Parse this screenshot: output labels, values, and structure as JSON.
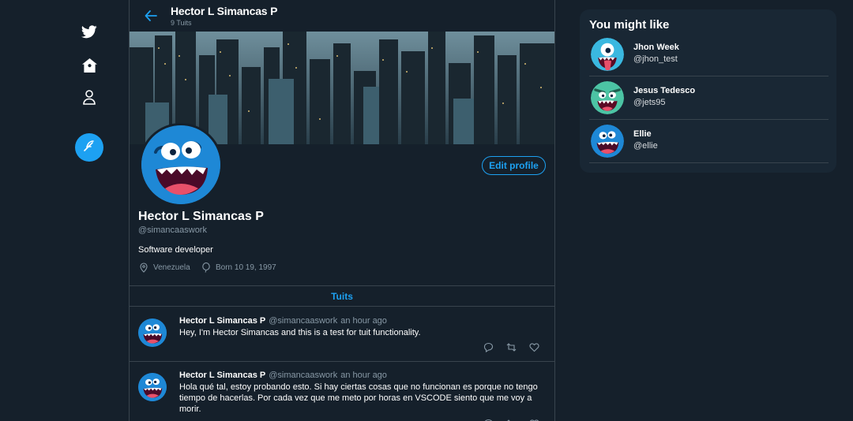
{
  "nav": {
    "items": [
      {
        "icon": "twitter-bird-icon"
      },
      {
        "icon": "home-icon"
      },
      {
        "icon": "profile-icon"
      }
    ],
    "compose_icon": "compose-feather-icon"
  },
  "header": {
    "name": "Hector L Simancas P",
    "tweet_count": "9 Tuits"
  },
  "profile": {
    "name": "Hector L Simancas P",
    "handle": "@simancaaswork",
    "bio": "Software developer",
    "location": "Venezuela",
    "birthday": "Born 10 19, 1997",
    "edit_label": "Edit profile"
  },
  "tabs": [
    {
      "label": "Tuits"
    }
  ],
  "tweets": [
    {
      "author": "Hector L Simancas P",
      "handle": "@simancaaswork",
      "time": "an hour ago",
      "text": "Hey, I'm Hector Simancas and this is a test for tuit functionality."
    },
    {
      "author": "Hector L Simancas P",
      "handle": "@simancaaswork",
      "time": "an hour ago",
      "text": "Hola qué tal, estoy probando esto. Si hay ciertas cosas que no funcionan es porque no tengo tiempo de hacerlas. Por cada vez que me meto por horas en VSCODE siento que me voy a morir."
    }
  ],
  "suggestions": {
    "title": "You might like",
    "users": [
      {
        "name": "Jhon Week",
        "handle": "@jhon_test"
      },
      {
        "name": "Jesus Tedesco",
        "handle": "@jets95"
      },
      {
        "name": "Ellie",
        "handle": "@ellie"
      }
    ]
  },
  "colors": {
    "background": "#15202b",
    "card": "#192734",
    "accent": "#1da1f2",
    "border": "#38444d",
    "muted": "#8899a6"
  }
}
